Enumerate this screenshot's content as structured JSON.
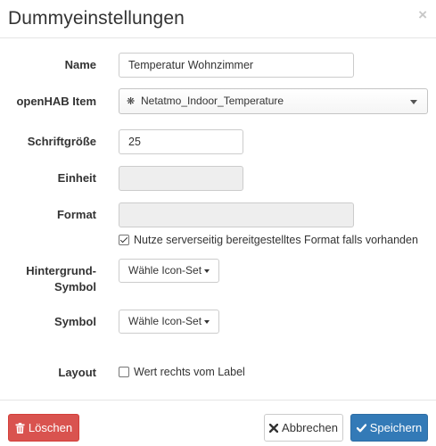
{
  "dialog": {
    "title": "Dummyeinstellungen",
    "close_symbol": "×"
  },
  "form": {
    "name_label": "Name",
    "name_value": "Temperatur Wohnzimmer",
    "item_label": "openHAB Item",
    "item_icon": "asterisk-icon",
    "item_value": "Netatmo_Indoor_Temperature",
    "fontsize_label": "Schriftgröße",
    "fontsize_value": "25",
    "unit_label": "Einheit",
    "unit_value": "",
    "format_label": "Format",
    "format_value": "",
    "use_server_format_label": "Nutze serverseitig bereitgestelltes Format falls vorhanden",
    "use_server_format_checked": true,
    "bg_symbol_label_line1": "Hintergrund-",
    "bg_symbol_label_line2": "Symbol",
    "bg_symbol_button": "Wähle Icon-Set",
    "symbol_label": "Symbol",
    "symbol_button": "Wähle Icon-Set",
    "layout_label": "Layout",
    "layout_option": "Wert rechts vom Label",
    "layout_option_checked": false
  },
  "footer": {
    "delete_label": "Löschen",
    "cancel_label": "Abbrechen",
    "save_label": "Speichern"
  },
  "colors": {
    "danger": "#d9534f",
    "primary": "#337ab7",
    "disabled_input": "#eeeeee"
  }
}
